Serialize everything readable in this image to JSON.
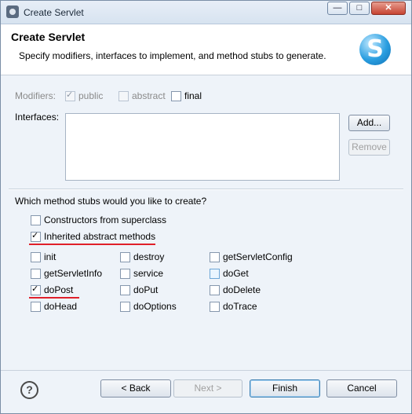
{
  "window": {
    "title": "Create Servlet",
    "min_glyph": "—",
    "max_glyph": "□",
    "close_glyph": "✕"
  },
  "header": {
    "title": "Create Servlet",
    "description": "Specify modifiers, interfaces to implement, and method stubs to generate.",
    "logo_letter": "S"
  },
  "modifiers": {
    "label": "Modifiers:",
    "public": {
      "label": "public",
      "checked": true,
      "enabled": false
    },
    "abstract": {
      "label": "abstract",
      "checked": false,
      "enabled": false
    },
    "final": {
      "label": "final",
      "checked": false,
      "enabled": true
    }
  },
  "interfaces": {
    "label": "Interfaces:",
    "add_label": "Add...",
    "remove_label": "Remove"
  },
  "stubs": {
    "question": "Which method stubs would you like to create?",
    "constructors": {
      "label": "Constructors from superclass",
      "checked": false
    },
    "inherited": {
      "label": "Inherited abstract methods",
      "checked": true
    },
    "methods": [
      {
        "label": "init",
        "checked": false
      },
      {
        "label": "destroy",
        "checked": false
      },
      {
        "label": "getServletConfig",
        "checked": false
      },
      {
        "label": "getServletInfo",
        "checked": false
      },
      {
        "label": "service",
        "checked": false
      },
      {
        "label": "doGet",
        "checked": false
      },
      {
        "label": "doPost",
        "checked": true
      },
      {
        "label": "doPut",
        "checked": false
      },
      {
        "label": "doDelete",
        "checked": false
      },
      {
        "label": "doHead",
        "checked": false
      },
      {
        "label": "doOptions",
        "checked": false
      },
      {
        "label": "doTrace",
        "checked": false
      }
    ]
  },
  "footer": {
    "help_glyph": "?",
    "back_label": "< Back",
    "next_label": "Next >",
    "finish_label": "Finish",
    "cancel_label": "Cancel"
  }
}
